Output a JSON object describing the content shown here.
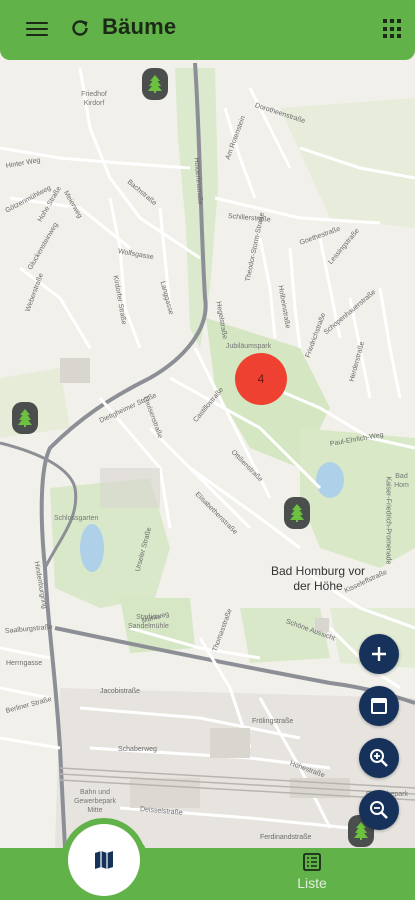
{
  "header": {
    "title": "Bäume"
  },
  "map": {
    "cluster_count": "4",
    "city_label": "Bad Homburg vor der Höhe",
    "places": [
      {
        "label": "Friedhof Kirdorf"
      },
      {
        "label": "Schlossgarten"
      },
      {
        "label": "Stadion Sandelmühle"
      },
      {
        "label": "Jubiläumspark"
      },
      {
        "label": "Bad Hom"
      },
      {
        "label": "Bahn und Gewerbepark Mitte"
      },
      {
        "label": "Gewerbepark"
      }
    ],
    "streets": [
      "Hölderlinstraße",
      "Dorotheenstraße",
      "Am Rotenstein",
      "Hinter Weg",
      "Götzenmühlweg",
      "Hohe Straße",
      "Meierweg",
      "Bachstraße",
      "Kirdorfer Straße",
      "Gluckensteinweg",
      "Weberstraße",
      "Wolfsgasse",
      "Langgasse",
      "Schillerstraße",
      "Hegelstraße",
      "Theodor-Storm-Straße",
      "Goethestraße",
      "Lessingstraße",
      "Holbeinstraße",
      "Schopenhauerstraße",
      "Herderstraße",
      "Friedrichstraße",
      "Dietigheimer Straße",
      "Castillostraße",
      "Ottilienstraße",
      "Paul-Ehrlich-Weg",
      "Elisabethenstraße",
      "Hindenburgring",
      "Louisenstraße",
      "Kaiser-Friedrich-Promenade",
      "Kisseleffstraße",
      "Mühlweg",
      "Thomasstraße",
      "Schöne Aussicht",
      "Saalburgstraße",
      "Herrngasse",
      "Berliner Straße",
      "Jacobistraße",
      "Frölingstraße",
      "Schaberweg",
      "Höhestraße",
      "Deisselstraße",
      "Ferdinandstraße",
      "Urseler Straße"
    ]
  },
  "controls": {
    "zoom_in_label": "+",
    "layers_icon": "layers-icon",
    "zoom_plus_icon": "zoom-in-icon",
    "zoom_minus_icon": "zoom-out-icon"
  },
  "bottom_nav": {
    "map_icon": "map-icon",
    "list_label": "Liste"
  },
  "colors": {
    "brand_green": "#62b24a",
    "cluster_red": "#ee4131",
    "fab_navy": "#16325a",
    "pin_gray": "#4a4f4e"
  }
}
